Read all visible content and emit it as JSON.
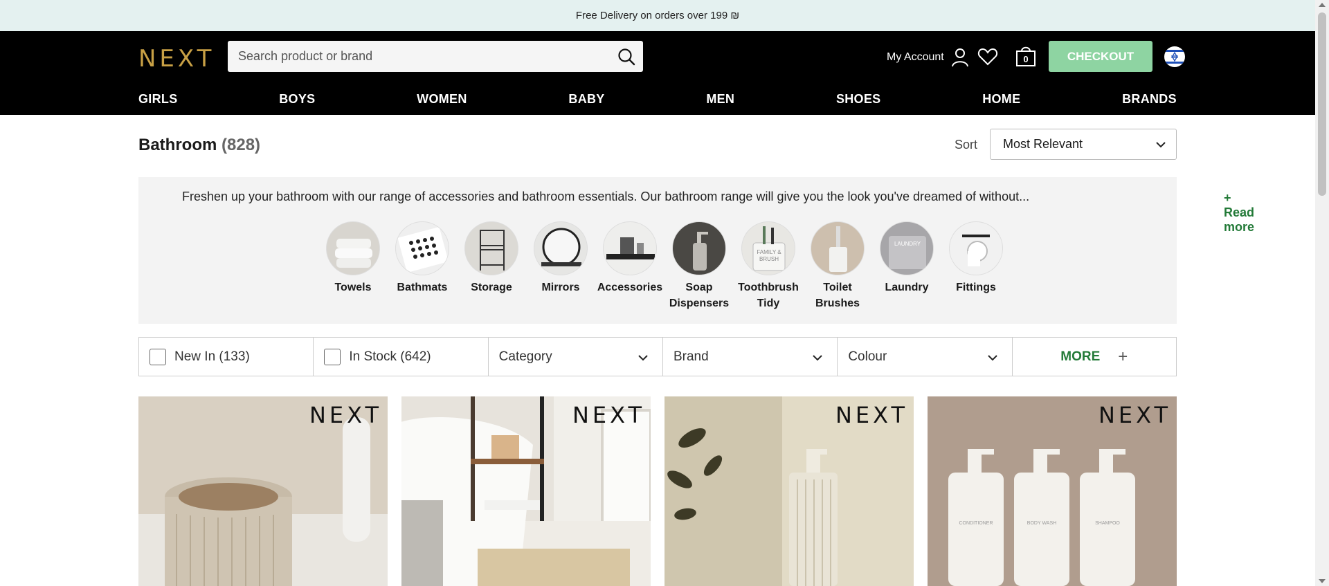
{
  "promo": {
    "text": "Free Delivery on orders over 199 ₪"
  },
  "header": {
    "logo": "NEXT",
    "search_placeholder": "Search product or brand",
    "account_label": "My Account",
    "bag_count": "0",
    "checkout_label": "CHECKOUT",
    "checkout_color": "#8ed4a2",
    "logo_color": "#c8a045"
  },
  "nav": [
    "GIRLS",
    "BOYS",
    "WOMEN",
    "BABY",
    "MEN",
    "SHOES",
    "HOME",
    "BRANDS"
  ],
  "page": {
    "title": "Bathroom",
    "count": "(828)",
    "sort_label": "Sort",
    "sort_value": "Most Relevant"
  },
  "intro": {
    "text": "Freshen up your bathroom with our range of accessories and bathroom essentials. Our bathroom range will give you the look you've dreamed of without...",
    "read_more": "+ Read more"
  },
  "categories": [
    {
      "line1": "Towels",
      "line2": ""
    },
    {
      "line1": "Bathmats",
      "line2": ""
    },
    {
      "line1": "Storage",
      "line2": ""
    },
    {
      "line1": "Mirrors",
      "line2": ""
    },
    {
      "line1": "Accessories",
      "line2": ""
    },
    {
      "line1": "Soap",
      "line2": "Dispensers"
    },
    {
      "line1": "Toothbrush",
      "line2": "Tidy"
    },
    {
      "line1": "Toilet",
      "line2": "Brushes"
    },
    {
      "line1": "Laundry",
      "line2": ""
    },
    {
      "line1": "Fittings",
      "line2": ""
    }
  ],
  "filters": {
    "new_in": "New In (133)",
    "in_stock": "In Stock (642)",
    "category": "Category",
    "brand": "Brand",
    "colour": "Colour",
    "more": "MORE",
    "more_icon": "+"
  },
  "products": [
    {
      "brand": "NEXT"
    },
    {
      "brand": "NEXT"
    },
    {
      "brand": "NEXT"
    },
    {
      "brand": "NEXT"
    }
  ],
  "product_bottle_labels": [
    "CONDITIONER",
    "BODY WASH",
    "SHAMPOO"
  ],
  "toothbrush_tidy_text": [
    "FAMILY &",
    "BRUSH"
  ],
  "laundry_text": "LAUNDRY",
  "accent_green": "#237a38"
}
